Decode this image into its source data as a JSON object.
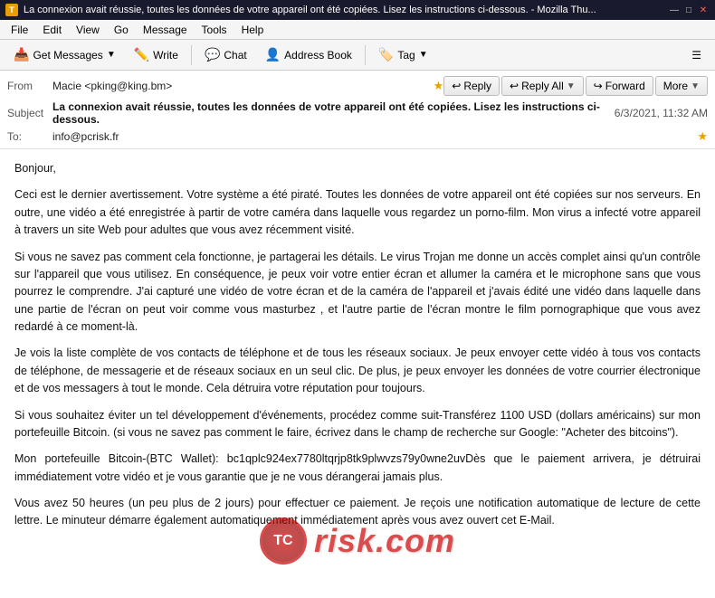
{
  "window": {
    "title": "La connexion avait réussie, toutes les données de votre appareil ont été copiées. Lisez les instructions ci-dessous. - Mozilla Thu...",
    "icon": "T"
  },
  "titlebar": {
    "minimize": "—",
    "maximize": "□",
    "close": "✕"
  },
  "menubar": {
    "items": [
      "File",
      "Edit",
      "View",
      "Go",
      "Message",
      "Tools",
      "Help"
    ]
  },
  "toolbar": {
    "get_messages": "Get Messages",
    "write": "Write",
    "chat": "Chat",
    "address_book": "Address Book",
    "tag": "Tag",
    "hamburger": "☰"
  },
  "email": {
    "from_label": "From",
    "from_value": "Macie <pking@king.bm>",
    "reply_label": "Reply",
    "reply_all_label": "Reply All",
    "forward_label": "Forward",
    "more_label": "More",
    "subject_label": "Subject",
    "subject_value": "La connexion avait réussie, toutes les données de votre appareil ont été copiées. Lisez les instructions ci-dessous.",
    "date_value": "6/3/2021, 11:32 AM",
    "to_label": "To:",
    "to_value": "info@pcrisk.fr",
    "body_paragraphs": [
      "Bonjour,",
      "Ceci  est  le  dernier  avertissement.  Votre  système  a  été  piraté.  Toutes  les  données  de  votre  appareil ont  été  copiées  sur  nos  serveurs.  En  outre,  une  vidéo  a  été  enregistrée  à  partir  de  votre  caméra dans  laquelle  vous  regardez  un  porno-film.  Mon  virus  a  infecté  votre  appareil  à  travers  un  site  Web pour  adultes  que  vous  avez  récemment  visité.",
      "Si  vous  ne  savez  pas  comment  cela  fonctionne,  je  partagerai  les  détails.  Le  virus  Trojan  me  donne un  accès  complet  ainsi  qu'un  contrôle  sur  l'appareil  que  vous  utilisez.  En  conséquence,  je  peux voir  votre  entier  écran  et  allumer  la  caméra  et  le  microphone  sans  que  vous  pourrez  le  comprendre. J'ai  capturé  une  vidéo  de  votre  écran  et  de  la  caméra  de  l'appareil  et  j'avais  édité  une  vidéo dans  laquelle  dans  une  partie  de  l'écran  on  peut  voir  comme  vous  masturbez ,  et  l'autre  partie  de l'écran  montre  le  film  pornographique  que  vous  avez  redardé  à  ce  moment-là.",
      "Je  vois  la  liste  complète  de  vos  contacts  de  téléphone  et  de  tous  les  réseaux  sociaux.  Je  peux envoyer  cette  vidéo  à  tous  vos  contacts  de  téléphone,  de  messagerie  et  de  réseaux  sociaux  en  un seul  clic.  De  plus,  je  peux  envoyer  les  données  de  votre  courrier  électronique  et  de  vos  messagers à  tout  le  monde.  Cela  détruira  votre  réputation  pour  toujours.",
      "Si  vous  souhaitez  éviter  un  tel  développement  d'événements,  procédez  comme  suit-Transférez  1100  USD (dollars  américains)  sur  mon  portefeuille  Bitcoin.  (si  vous  ne  savez  pas  comment  le  faire,  écrivez dans  le  champ  de  recherche  sur  Google:  \"Acheter  des  bitcoins\").",
      "Mon  portefeuille  Bitcoin-(BTC  Wallet):  bc1qplc924ex7780ltqrjp8tk9plwvzs79y0wne2uvDès  que  le  paiement arrivera,  je  détruirai  immédiatement  votre  vidéo  et  je  vous  garantie  que  je  ne  vous  dérangerai jamais  plus.",
      "Vous  avez  50  heures  (un  peu  plus  de  2  jours)  pour  effectuer  ce  paiement.  Je  reçois  une notification  automatique  de  lecture  de  cette  lettre.  Le  minuteur  démarre  également  automatiquement immédiatement  après  vous  avez  ouvert  cet  E-Mail."
    ]
  },
  "watermark": {
    "text": "risk.com"
  }
}
